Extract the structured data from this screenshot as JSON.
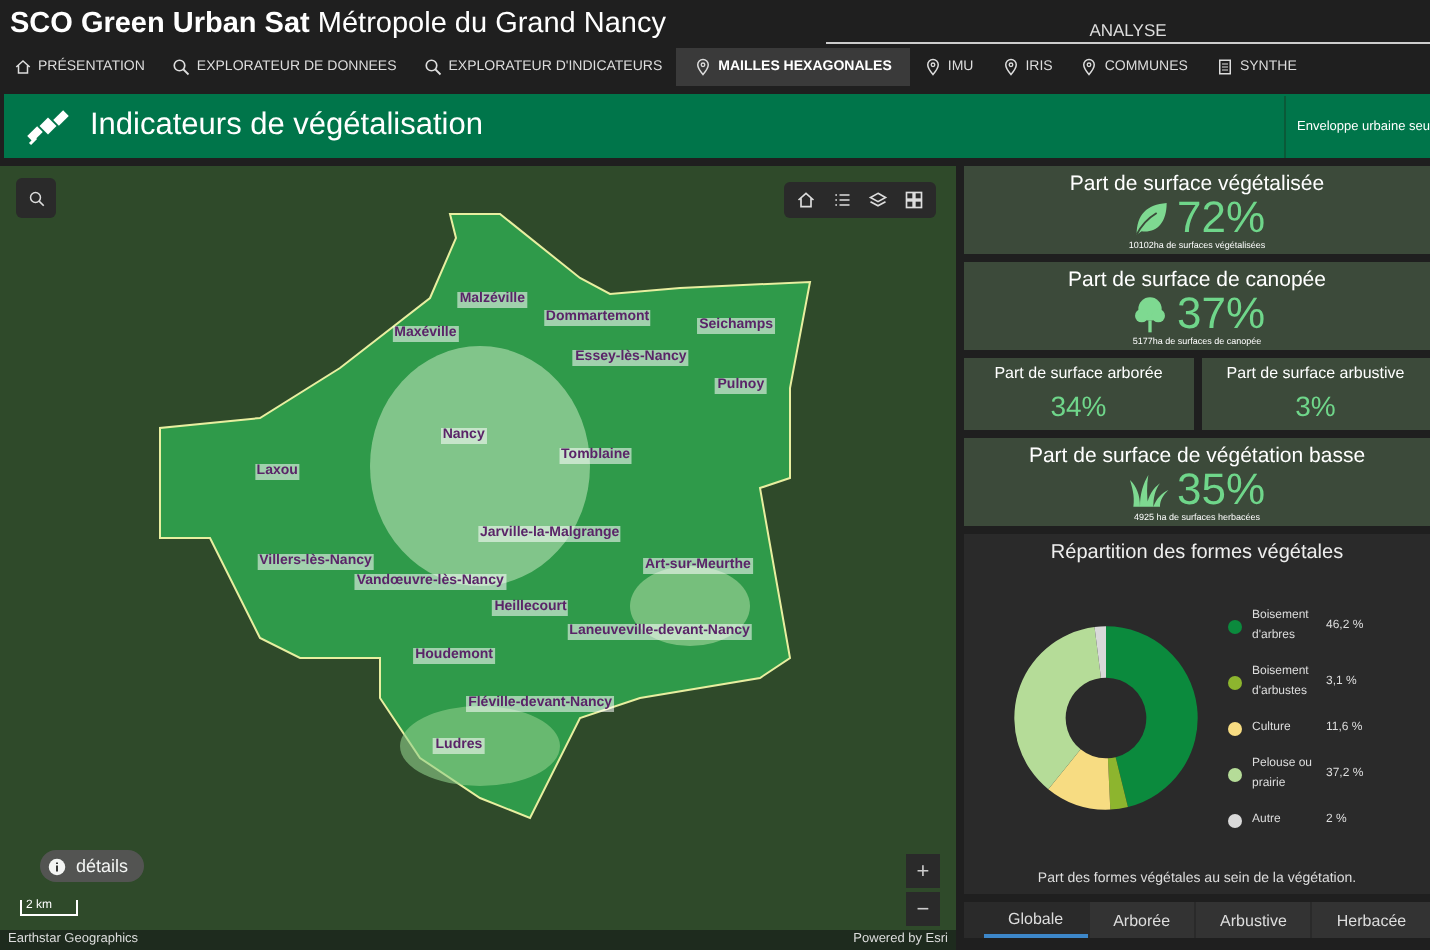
{
  "app": {
    "title_bold": "SCO Green Urban Sat",
    "title_rest": "Métropole du Grand Nancy",
    "section": "ANALYSE"
  },
  "nav": [
    {
      "label": "PRÉSENTATION",
      "selected": false
    },
    {
      "label": "EXPLORATEUR DE DONNEES",
      "selected": false
    },
    {
      "label": "EXPLORATEUR D'INDICATEURS",
      "selected": false
    },
    {
      "label": "MAILLES HEXAGONALES",
      "selected": true
    },
    {
      "label": "IMU",
      "selected": false
    },
    {
      "label": "IRIS",
      "selected": false
    },
    {
      "label": "COMMUNES",
      "selected": false
    },
    {
      "label": "SYNTHE",
      "selected": false
    }
  ],
  "header": {
    "title": "Indicateurs de végétalisation",
    "right_text": "Enveloppe urbaine seu"
  },
  "map": {
    "labels": [
      "Malzéville",
      "Dommartemont",
      "Maxéville",
      "Seichamps",
      "Essey-lès-Nancy",
      "Pulnoy",
      "Laxou",
      "Nancy",
      "Tomblaine",
      "Jarville-la-Malgrange",
      "Villers-lès-Nancy",
      "Vandœuvre-lès-Nancy",
      "Art-sur-Meurthe",
      "Heillecourt",
      "Laneuveville-devant-Nancy",
      "Houdemont",
      "Fléville-devant-Nancy",
      "Ludres"
    ],
    "details_button": "détails",
    "scale": "2 km",
    "zoom_in": "+",
    "zoom_out": "−",
    "attribution_left": "Earthstar Geographics",
    "attribution_right": "Powered by Esri"
  },
  "kpis": [
    {
      "kind": "big",
      "title": "Part de surface végétalisée",
      "value": "72%",
      "caption": "10102ha de surfaces végétalisées"
    },
    {
      "kind": "big",
      "title": "Part de surface de canopée",
      "value": "37%",
      "caption": "5177ha de surfaces de canopée"
    },
    {
      "kind": "half",
      "title": "Part de surface arborée",
      "value": "34%"
    },
    {
      "kind": "half",
      "title": "Part de surface arbustive",
      "value": "3%"
    },
    {
      "kind": "big",
      "title": "Part de surface de végétation basse",
      "value": "35%",
      "caption": "4925 ha de surfaces herbacées"
    }
  ],
  "distribution": {
    "title": "Répartition des formes végétales",
    "chart_data": {
      "type": "donut",
      "categories": [
        "Boisement d'arbres",
        "Boisement d'arbustes",
        "Culture",
        "Pelouse ou prairie",
        "Autre"
      ],
      "values": [
        46.2,
        3.1,
        11.6,
        37.2,
        2
      ]
    },
    "legend": [
      {
        "value": "46,2 %",
        "color": "#0b8a3d"
      },
      {
        "value": "3,1 %",
        "color": "#8db52e"
      },
      {
        "value": "11,6 %",
        "color": "#f7dc82"
      },
      {
        "value": "37,2 %",
        "color": "#b5dc98"
      },
      {
        "value": "2 %",
        "color": "#d9d9d9"
      }
    ],
    "caption": "Part des formes végétales au sein de la végétation."
  },
  "tabs": [
    {
      "label": "Globale",
      "selected": true
    },
    {
      "label": "Arborée",
      "selected": false
    },
    {
      "label": "Arbustive",
      "selected": false
    },
    {
      "label": "Herbacée",
      "selected": false
    }
  ]
}
